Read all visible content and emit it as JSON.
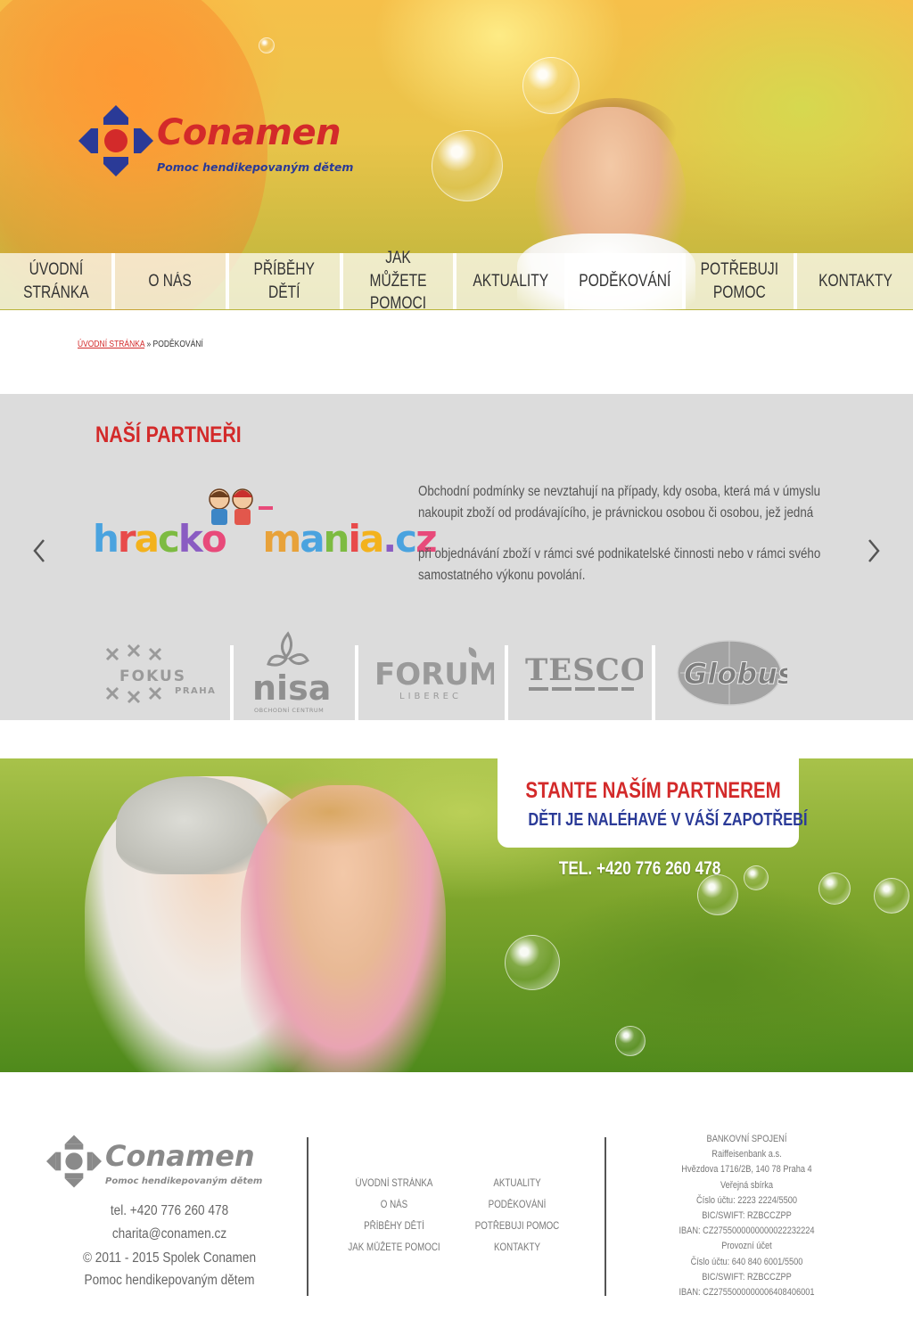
{
  "brand": {
    "name": "Conamen",
    "tagline": "Pomoc hendikepovaným dětem",
    "colors": {
      "red": "#d32a2a",
      "blue": "#2a3a97"
    }
  },
  "nav": {
    "items": [
      {
        "label": "ÚVODNÍ\nSTRÁNKA"
      },
      {
        "label": "O NÁS"
      },
      {
        "label": "PŘÍBĚHY\nDĚTÍ"
      },
      {
        "label": "JAK MŮŽETE\nPOMOCI"
      },
      {
        "label": "AKTUALITY"
      },
      {
        "label": "PODĚKOVÁNÍ",
        "active": true
      },
      {
        "label": "POTŘEBUJI\nPOMOC"
      },
      {
        "label": "KONTAKTY"
      }
    ]
  },
  "breadcrumb": {
    "home": "ÚVODNÍ STRÁNKA",
    "separator": "»",
    "current": "PODĚKOVÁNÍ"
  },
  "partners": {
    "title": "NAŠÍ PARTNEŘI",
    "featured": {
      "logo_text": "hrackomania.cz",
      "paragraphs": [
        "Obchodní podmínky se nevztahují na případy, kdy osoba, která má v úmyslu nakoupit zboží od prodávajícího, je právnickou osobou či osobou, jež jedná",
        "při objednávání zboží v rámci své podnikatelské činnosti nebo v rámci svého samostatného výkonu povolání."
      ]
    },
    "logos": [
      {
        "name": "FOKUS",
        "sub": "PRAHA"
      },
      {
        "name": "nisa",
        "sub": "OBCHODNÍ CENTRUM"
      },
      {
        "name": "FORUM",
        "sub": "LIBEREC"
      },
      {
        "name": "TESCO"
      },
      {
        "name": "Globus"
      }
    ]
  },
  "cta": {
    "title": "STANTE NAŠÍM PARTNEREM",
    "subtitle": "DĚTI JE NALÉHAVÉ  V VÁŠÍ ZAPOTŘEBÍ",
    "phone": "TEL. +420 776 260 478"
  },
  "footer": {
    "phone": "tel. +420 776 260 478",
    "email": "charita@conamen.cz",
    "copyright_line1": "© 2011 - 2015 Spolek Conamen",
    "copyright_line2": "Pomoc hendikepovaným dětem",
    "links_col1": [
      "ÚVODNÍ STRÁNKA",
      "O NÁS",
      "PŘÍBĚHY DĚTÍ",
      "JAK MŮŽETE POMOCI"
    ],
    "links_col2": [
      "AKTUALITY",
      "PODĚKOVÁNÍ",
      "POTŘEBUJI POMOC",
      "KONTAKTY"
    ],
    "bank": [
      "BANKOVNÍ SPOJENÍ",
      "Raiffeisenbank a.s.",
      "Hvězdova 1716/2B, 140 78 Praha 4",
      "Veřejná sbírka",
      "Číslo účtu: 2223 2224/5500",
      "BIC/SWIFT: RZBCCZPP",
      "IBAN: CZ2755000000000022232224",
      "Provozní účet",
      "Číslo účtu: 640 840 6001/5500",
      "BIC/SWIFT: RZBCCZPP",
      "IBAN: CZ2755000000006408406001"
    ]
  }
}
